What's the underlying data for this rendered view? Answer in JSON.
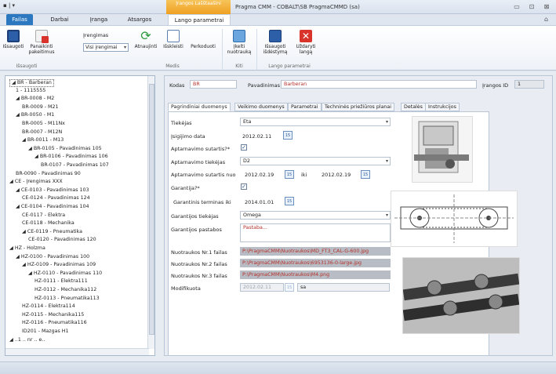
{
  "window": {
    "qat": "▪ | ▾",
    "context_tab": "Įrangos Lašštaašini",
    "title": "Pragma CMM - COBALT\\SB PragmaCMMD (sa)",
    "controls": [
      "▭",
      "⊡",
      "⊠"
    ]
  },
  "tabs": [
    "Failas",
    "Darbai",
    "Įranga",
    "Atsargos",
    "Lango parametrai"
  ],
  "ribbon": {
    "buttons": {
      "save": "Išsaugoti",
      "cancel": "Panaikinti pakeitimus",
      "refresh": "Atnaujinti",
      "expand": "Išskleisti",
      "collapse": "Perkoduoti",
      "load": "Įkelti nuotrauką",
      "save_layout": "Išsaugoti išdėstymą",
      "close_window": "Uždaryti langą"
    },
    "equipment_label": "Įrengimas",
    "equipment_select": "Visi įrengimai",
    "groups": [
      "Išsaugoti",
      "Medis",
      "Kiti",
      "Lango parametrai"
    ]
  },
  "tree": [
    {
      "text": "◢  BR - Barberan",
      "level": 0,
      "selected": true
    },
    {
      "text": "1 - 1115555",
      "level": 1
    },
    {
      "text": "◢  BR-0008 - M2",
      "level": 1
    },
    {
      "text": "BR-0009 - M21",
      "level": 2
    },
    {
      "text": "◢  BR-0050 - M1",
      "level": 1
    },
    {
      "text": "BR-0005 - M11Nx",
      "level": 2
    },
    {
      "text": "BR-0007 - M12N",
      "level": 2
    },
    {
      "text": "◢  BR-0011 - M13",
      "level": 2
    },
    {
      "text": "◢  BR-0105 - Pavadinimas 105",
      "level": 3
    },
    {
      "text": "◢  BR-0106 - Pavadinimas 106",
      "level": 4
    },
    {
      "text": "BR-0107 - Pavadinimas 107",
      "level": 5
    },
    {
      "text": "BR-0090 - Pavadinimas 90",
      "level": 1
    },
    {
      "text": "◢  CE - Įrengimas XXX",
      "level": 0
    },
    {
      "text": "◢  CE-0103 - Pavadinimas 103",
      "level": 1
    },
    {
      "text": "CE-0124 - Pavadinimas 124",
      "level": 2
    },
    {
      "text": "◢  CE-0104 - Pavadinimas 104",
      "level": 1
    },
    {
      "text": "CE-0117 - Elektra",
      "level": 2
    },
    {
      "text": "CE-0118 - Mechanika",
      "level": 2
    },
    {
      "text": "◢  CE-0119 - Pneumatika",
      "level": 2
    },
    {
      "text": "CE-0120 - Pavadinimas 120",
      "level": 3
    },
    {
      "text": "◢  HZ - Holzma",
      "level": 0
    },
    {
      "text": "◢  HZ-0100 - Pavadinimas 100",
      "level": 1
    },
    {
      "text": "◢  HZ-0109 - Pavadinimas 109",
      "level": 2
    },
    {
      "text": "◢  HZ-0110 - Pavadinimas 110",
      "level": 3
    },
    {
      "text": "HZ-0111 - Elektra111",
      "level": 4
    },
    {
      "text": "HZ-0112 - Mechanika112",
      "level": 4
    },
    {
      "text": "HZ-0113 - Pneumatika113",
      "level": 4
    },
    {
      "text": "HZ-0114 - Elektra114",
      "level": 2
    },
    {
      "text": "HZ-0115 - Mechanika115",
      "level": 2
    },
    {
      "text": "HZ-0116 - Pneumatika116",
      "level": 2
    },
    {
      "text": "ID201 - Mazgas H1",
      "level": 2
    },
    {
      "text": "◢  ..1 .. nr .. e..",
      "level": 0
    }
  ],
  "header": {
    "code_label": "Kodas",
    "code_value": "BR",
    "name_label": "Pavadinimas",
    "name_value": "Barberan",
    "id_label": "Įrangos ID",
    "id_value": "1"
  },
  "subtabs": [
    "Pagrindiniai duomenys",
    "Veikimo duomenys",
    "Parametrai",
    "Techninės priežiūros planai",
    "Detalės",
    "Instrukcijos"
  ],
  "form": {
    "supplier_label": "Tiekėjas",
    "supplier_value": "Eta",
    "purchase_label": "Įsigijimo data",
    "purchase_value": "2012.02.11",
    "service_contract_label": "Aptarnavimo sutartis?*",
    "service_supplier_label": "Aptarnavimo tiekėjas",
    "service_supplier_value": "D2",
    "service_from_label": "Aptarnavimo sutartis nuo",
    "service_from_value": "2012.02.19",
    "until_label": "iki",
    "service_to_value": "2012.02.19",
    "warranty_label": "Garantija?*",
    "warranty_term_label": "Garantinis terminas iki",
    "warranty_term_value": "2014.01.01",
    "warranty_supplier_label": "Garantijos tiekėjas",
    "warranty_supplier_value": "Omega",
    "warranty_notes_label": "Garantijos pastabos",
    "warranty_notes_value": "Pastaba...",
    "photo1_label": "Nuotraukos Nr.1 failas",
    "photo1_value": "P:\\PragmaCMM\\Nuotraukos\\MD_FT3_CAL-G-600.jpg",
    "photo2_label": "Nuotraukos Nr.2 failas",
    "photo2_value": "P:\\PragmaCMM\\Nuotraukos\\6953136-0-large.jpg",
    "photo3_label": "Nuotraukos Nr.3 failas",
    "photo3_value": "P:\\PragmaCMM\\Nuotraukos\\M4.png",
    "modified_label": "Modifikuota",
    "modified_date": "2012.02.11",
    "modified_user": "sa",
    "calendar_glyph": "15"
  },
  "colors": {
    "accent": "#2b78c0",
    "context": "#f0a020",
    "value_red": "#b5302a",
    "path_bg": "#b8bcc4"
  }
}
